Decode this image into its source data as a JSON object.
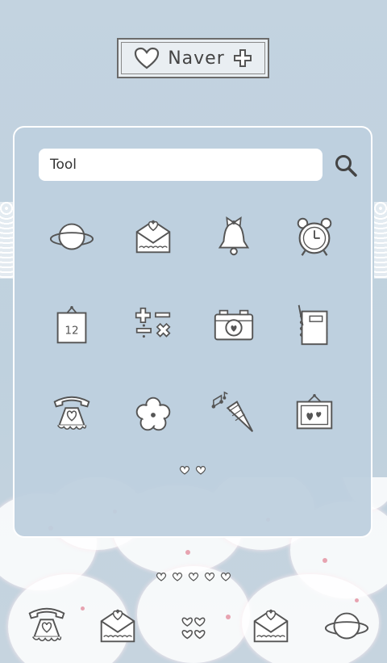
{
  "widget": {
    "label": "Naver",
    "left_icon": "heart-icon",
    "right_icon": "plus-icon"
  },
  "search": {
    "value": "Tool",
    "icon": "search-icon"
  },
  "apps": [
    {
      "icon": "planet-icon"
    },
    {
      "icon": "envelope-heart-icon"
    },
    {
      "icon": "bell-bow-icon"
    },
    {
      "icon": "alarm-clock-icon"
    },
    {
      "icon": "calendar-icon",
      "text": "12"
    },
    {
      "icon": "calculator-icon"
    },
    {
      "icon": "camera-icon"
    },
    {
      "icon": "notebook-icon"
    },
    {
      "icon": "telephone-icon"
    },
    {
      "icon": "flower-icon"
    },
    {
      "icon": "music-cone-icon"
    },
    {
      "icon": "picture-frame-icon"
    }
  ],
  "page_indicator": {
    "count": 2,
    "current": 1
  },
  "dock_page_indicator": {
    "count": 5,
    "current": 3
  },
  "dock": [
    {
      "icon": "telephone-icon"
    },
    {
      "icon": "envelope-heart-icon"
    },
    {
      "icon": "app-drawer-hearts-icon"
    },
    {
      "icon": "envelope-heart-icon"
    },
    {
      "icon": "planet-icon"
    }
  ],
  "colors": {
    "stroke": "#555555",
    "fill": "#ffffff",
    "panel": "#bed0de",
    "accent": "#e7a3b0"
  }
}
